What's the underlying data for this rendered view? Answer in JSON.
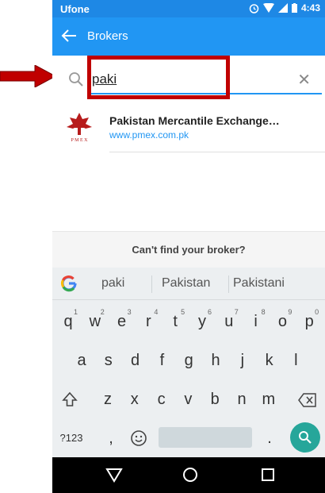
{
  "status": {
    "carrier": "Ufone",
    "time": "4:43"
  },
  "appbar": {
    "title": "Brokers"
  },
  "search": {
    "query": "paki"
  },
  "results": [
    {
      "name": "Pakistan Mercantile Exchange…",
      "url": "www.pmex.com.pk",
      "logo_text": "P M E X"
    }
  ],
  "cant_find": "Can't find your broker?",
  "keyboard": {
    "suggestions": [
      "paki",
      "Pakistan",
      "Pakistani"
    ],
    "row1": [
      [
        "q",
        "1"
      ],
      [
        "w",
        "2"
      ],
      [
        "e",
        "3"
      ],
      [
        "r",
        "4"
      ],
      [
        "t",
        "5"
      ],
      [
        "y",
        "6"
      ],
      [
        "u",
        "7"
      ],
      [
        "i",
        "8"
      ],
      [
        "o",
        "9"
      ],
      [
        "p",
        "0"
      ]
    ],
    "row2": [
      "a",
      "s",
      "d",
      "f",
      "g",
      "h",
      "j",
      "k",
      "l"
    ],
    "row3": [
      "z",
      "x",
      "c",
      "v",
      "b",
      "n",
      "m"
    ],
    "row4": {
      "symbols": "?123",
      "comma": ",",
      "period": "."
    }
  },
  "colors": {
    "status": "#1e88e5",
    "appbar": "#2196f3",
    "accent": "#26a69a",
    "annotation": "#c00000"
  }
}
